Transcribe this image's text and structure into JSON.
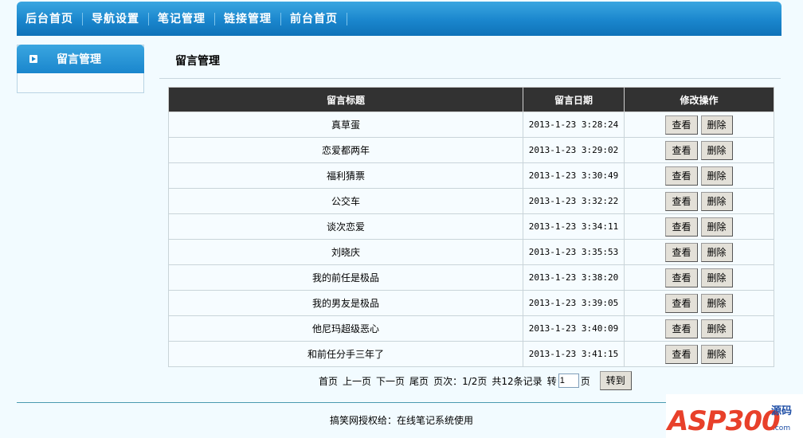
{
  "topnav": {
    "items": [
      "后台首页",
      "导航设置",
      "笔记管理",
      "链接管理",
      "前台首页"
    ]
  },
  "sidebar": {
    "title": "留言管理"
  },
  "main": {
    "title": "留言管理",
    "columns": [
      "留言标题",
      "留言日期",
      "修改操作"
    ],
    "rows": [
      {
        "title": "真草蛋",
        "date": "2013-1-23 3:28:24"
      },
      {
        "title": "恋爱都两年",
        "date": "2013-1-23 3:29:02"
      },
      {
        "title": "福利猜票",
        "date": "2013-1-23 3:30:49"
      },
      {
        "title": "公交车",
        "date": "2013-1-23 3:32:22"
      },
      {
        "title": "谈次恋爱",
        "date": "2013-1-23 3:34:11"
      },
      {
        "title": "刘晓庆",
        "date": "2013-1-23 3:35:53"
      },
      {
        "title": "我的前任是极品",
        "date": "2013-1-23 3:38:20"
      },
      {
        "title": "我的男友是极品",
        "date": "2013-1-23 3:39:05"
      },
      {
        "title": "他尼玛超级恶心",
        "date": "2013-1-23 3:40:09"
      },
      {
        "title": "和前任分手三年了",
        "date": "2013-1-23 3:41:15"
      }
    ],
    "view_label": "查看",
    "delete_label": "删除"
  },
  "pager": {
    "first": "首页",
    "prev": "上一页",
    "next": "下一页",
    "last": "尾页",
    "page_info": "页次：1/2页",
    "total": "共12条记录",
    "goto_prefix": "转",
    "goto_value": "1",
    "goto_suffix": "页",
    "goto_button": "转到"
  },
  "footer": {
    "text": "搞笑网授权给：在线笔记系统使用"
  },
  "watermark": {
    "main": "ASP300",
    "sub": "源码",
    "url": ".com"
  }
}
